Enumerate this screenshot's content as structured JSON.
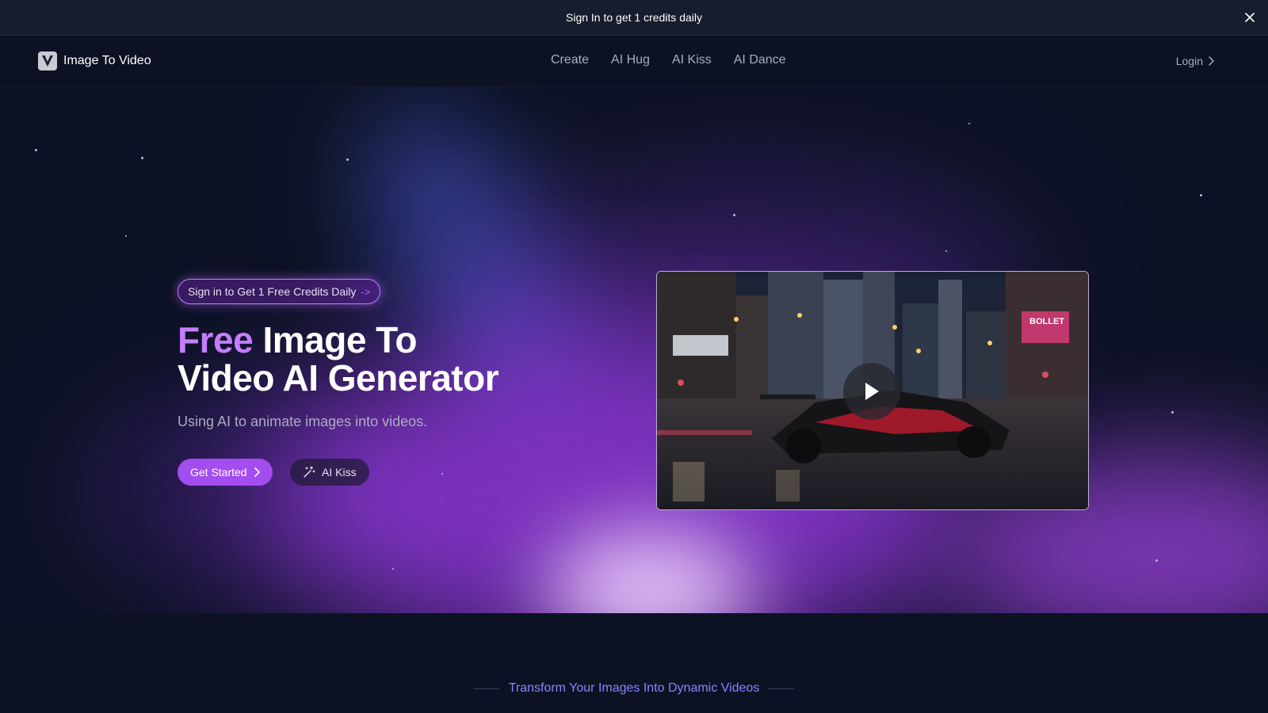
{
  "banner": {
    "text": "Sign In to get 1 credits daily",
    "close_icon": "close-icon"
  },
  "navbar": {
    "brand_letter": "V",
    "brand_name": "Image To Video",
    "links": [
      "Create",
      "AI Hug",
      "AI Kiss",
      "AI Dance"
    ],
    "login_label": "Login"
  },
  "hero": {
    "badge_text": "Sign in to Get 1 Free Credits Daily",
    "badge_arrow": "->",
    "title_accent": "Free",
    "title_rest": " Image To",
    "title_line2": "Video AI Generator",
    "subtitle": "Using AI to animate images into videos.",
    "primary_button": "Get Started",
    "secondary_button": "AI Kiss",
    "secondary_icon": "magic-wand-icon"
  },
  "video": {
    "play_icon": "play-icon",
    "billboard_text": "BOLLET"
  },
  "section": {
    "heading": "Transform Your Images Into Dynamic Videos"
  },
  "colors": {
    "accent": "#a34cf0",
    "title_accent": "#c57dff",
    "background": "#0c1224",
    "section_heading": "#8b84ff"
  }
}
